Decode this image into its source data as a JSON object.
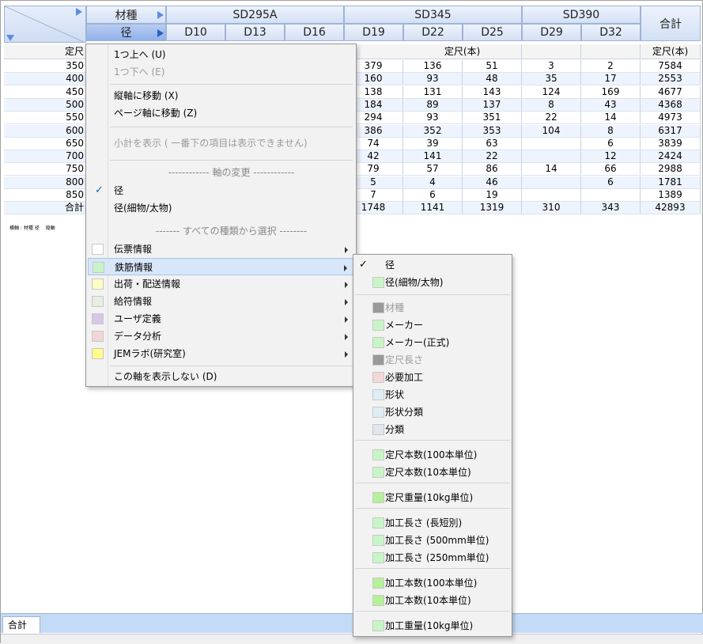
{
  "header": {
    "axis_material_label": "材種",
    "axis_diameter_label": "径",
    "total_label": "合計",
    "groups": [
      "SD295A",
      "SD345",
      "SD390"
    ],
    "diameters": [
      "D10",
      "D13",
      "D16",
      "D19",
      "D22",
      "D25",
      "D29",
      "D32"
    ]
  },
  "grid": {
    "subhead_left": "定尺",
    "subhead_mid": "定尺(本)",
    "subhead_total": "定尺(本)",
    "row_labels": [
      "350",
      "400",
      "450",
      "500",
      "550",
      "600",
      "650",
      "700",
      "750",
      "800",
      "850",
      "合計"
    ],
    "rows": [
      [
        "379",
        "136",
        "51",
        "3",
        "2",
        "7584"
      ],
      [
        "160",
        "93",
        "48",
        "35",
        "17",
        "2553"
      ],
      [
        "138",
        "131",
        "143",
        "124",
        "169",
        "4677"
      ],
      [
        "184",
        "89",
        "137",
        "8",
        "43",
        "4368"
      ],
      [
        "294",
        "93",
        "351",
        "22",
        "14",
        "4973"
      ],
      [
        "386",
        "352",
        "353",
        "104",
        "8",
        "6317"
      ],
      [
        "74",
        "39",
        "63",
        "",
        "6",
        "3839"
      ],
      [
        "42",
        "141",
        "22",
        "",
        "12",
        "2424"
      ],
      [
        "79",
        "57",
        "86",
        "14",
        "66",
        "2988"
      ],
      [
        "5",
        "4",
        "46",
        "",
        "6",
        "1781"
      ],
      [
        "7",
        "6",
        "19",
        "",
        "",
        "1389"
      ],
      [
        "1748",
        "1141",
        "1319",
        "310",
        "343",
        "42893"
      ]
    ],
    "footnote_a": "横軸 : 材種 径",
    "footnote_b": "縦軸"
  },
  "menu": {
    "move_up": "1つ上へ (U)",
    "move_down": "1つ下へ (E)",
    "move_vertical": "縦軸に移動 (X)",
    "move_page": "ページ軸に移動 (Z)",
    "show_subtotal": "小計を表示 ( 一番下の項目は表示できません)",
    "axis_change_caption": "------------ 軸の変更 ------------",
    "diameter": "径",
    "diameter_thin_thick": "径(細物/太物)",
    "select_all_caption": "------- すべての種類から選択 --------",
    "categories": [
      {
        "label": "伝票情報",
        "color": "#ffffff"
      },
      {
        "label": "鉄筋情報",
        "color": "#c8f5c8"
      },
      {
        "label": "出荷・配送情報",
        "color": "#fdfdc4"
      },
      {
        "label": "給符情報",
        "color": "#e6eedf"
      },
      {
        "label": "ユーザ定義",
        "color": "#d7c7e6"
      },
      {
        "label": "データ分析",
        "color": "#f3d6d6"
      },
      {
        "label": "JEMラボ(研究室)",
        "color": "#fdfd8a"
      }
    ],
    "hide_axis": "この軸を表示しない (D)"
  },
  "submenu": {
    "items": [
      {
        "label": "径",
        "color": "",
        "checked": true,
        "disabled": false
      },
      {
        "label": "径(細物/太物)",
        "color": "#c8f5c8",
        "checked": false,
        "disabled": false
      },
      {
        "label": "材種",
        "color": "#999999",
        "checked": false,
        "disabled": true
      },
      {
        "label": "メーカー",
        "color": "#c8f5c8",
        "checked": false,
        "disabled": false
      },
      {
        "label": "メーカー(正式)",
        "color": "#c8f5c8",
        "checked": false,
        "disabled": false
      },
      {
        "label": "定尺長さ",
        "color": "#999999",
        "checked": false,
        "disabled": true
      },
      {
        "label": "必要加工",
        "color": "#f3d6d6",
        "checked": false,
        "disabled": false
      },
      {
        "label": "形状",
        "color": "#dfeef5",
        "checked": false,
        "disabled": false
      },
      {
        "label": "形状分類",
        "color": "#dfeef5",
        "checked": false,
        "disabled": false
      },
      {
        "label": "分類",
        "color": "#dfe6ee",
        "checked": false,
        "disabled": false
      },
      {
        "label": "定尺本数(100本単位)",
        "color": "#c8f5c8",
        "checked": false,
        "disabled": false
      },
      {
        "label": "定尺本数(10本単位)",
        "color": "#c8f5c8",
        "checked": false,
        "disabled": false
      },
      {
        "label": "定尺重量(10kg単位)",
        "color": "#b5f09a",
        "checked": false,
        "disabled": false
      },
      {
        "label": "加工長さ (長短別)",
        "color": "#c8f5c8",
        "checked": false,
        "disabled": false
      },
      {
        "label": "加工長さ (500mm単位)",
        "color": "#c8f5c8",
        "checked": false,
        "disabled": false
      },
      {
        "label": "加工長さ (250mm単位)",
        "color": "#c8f5c8",
        "checked": false,
        "disabled": false
      },
      {
        "label": "加工本数(100本単位)",
        "color": "#b5f09a",
        "checked": false,
        "disabled": false
      },
      {
        "label": "加工本数(10本単位)",
        "color": "#b5f09a",
        "checked": false,
        "disabled": false
      },
      {
        "label": "加工重量(10kg単位)",
        "color": "#c8f5c8",
        "checked": false,
        "disabled": false
      }
    ]
  },
  "bottom": {
    "tab_label": "合計"
  }
}
